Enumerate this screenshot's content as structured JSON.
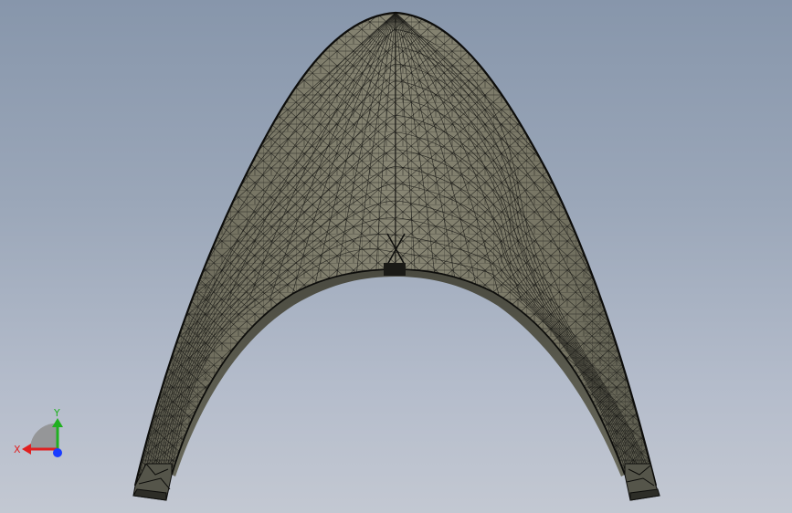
{
  "viewport": {
    "background_top": "#8796ab",
    "background_bottom": "#c3c8d2"
  },
  "model": {
    "shading_color": "#7a7867",
    "mesh_color": "#1a1a16",
    "edge_color": "#0d0d0b",
    "symmetry_marker": "X"
  },
  "triad": {
    "x_label": "X",
    "y_label": "Y",
    "x_color": "#e02020",
    "y_color": "#20b020",
    "z_color": "#1a3cff"
  }
}
